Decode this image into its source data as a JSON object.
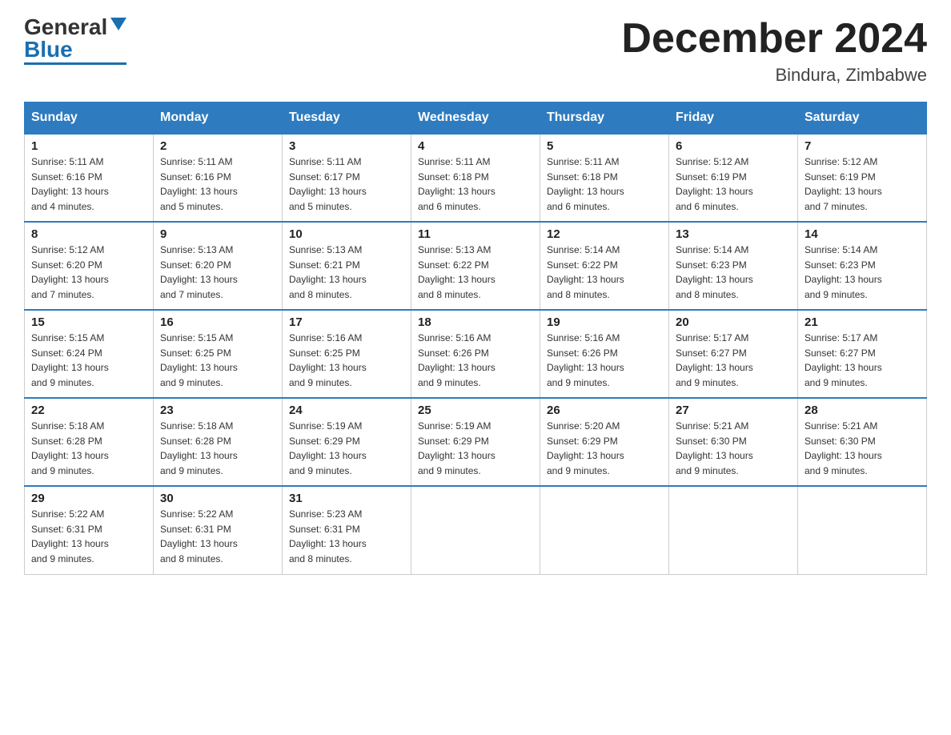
{
  "header": {
    "logo_general": "General",
    "logo_blue": "Blue",
    "month_title": "December 2024",
    "subtitle": "Bindura, Zimbabwe"
  },
  "weekdays": [
    "Sunday",
    "Monday",
    "Tuesday",
    "Wednesday",
    "Thursday",
    "Friday",
    "Saturday"
  ],
  "weeks": [
    [
      {
        "day": "1",
        "info": "Sunrise: 5:11 AM\nSunset: 6:16 PM\nDaylight: 13 hours\nand 4 minutes."
      },
      {
        "day": "2",
        "info": "Sunrise: 5:11 AM\nSunset: 6:16 PM\nDaylight: 13 hours\nand 5 minutes."
      },
      {
        "day": "3",
        "info": "Sunrise: 5:11 AM\nSunset: 6:17 PM\nDaylight: 13 hours\nand 5 minutes."
      },
      {
        "day": "4",
        "info": "Sunrise: 5:11 AM\nSunset: 6:18 PM\nDaylight: 13 hours\nand 6 minutes."
      },
      {
        "day": "5",
        "info": "Sunrise: 5:11 AM\nSunset: 6:18 PM\nDaylight: 13 hours\nand 6 minutes."
      },
      {
        "day": "6",
        "info": "Sunrise: 5:12 AM\nSunset: 6:19 PM\nDaylight: 13 hours\nand 6 minutes."
      },
      {
        "day": "7",
        "info": "Sunrise: 5:12 AM\nSunset: 6:19 PM\nDaylight: 13 hours\nand 7 minutes."
      }
    ],
    [
      {
        "day": "8",
        "info": "Sunrise: 5:12 AM\nSunset: 6:20 PM\nDaylight: 13 hours\nand 7 minutes."
      },
      {
        "day": "9",
        "info": "Sunrise: 5:13 AM\nSunset: 6:20 PM\nDaylight: 13 hours\nand 7 minutes."
      },
      {
        "day": "10",
        "info": "Sunrise: 5:13 AM\nSunset: 6:21 PM\nDaylight: 13 hours\nand 8 minutes."
      },
      {
        "day": "11",
        "info": "Sunrise: 5:13 AM\nSunset: 6:22 PM\nDaylight: 13 hours\nand 8 minutes."
      },
      {
        "day": "12",
        "info": "Sunrise: 5:14 AM\nSunset: 6:22 PM\nDaylight: 13 hours\nand 8 minutes."
      },
      {
        "day": "13",
        "info": "Sunrise: 5:14 AM\nSunset: 6:23 PM\nDaylight: 13 hours\nand 8 minutes."
      },
      {
        "day": "14",
        "info": "Sunrise: 5:14 AM\nSunset: 6:23 PM\nDaylight: 13 hours\nand 9 minutes."
      }
    ],
    [
      {
        "day": "15",
        "info": "Sunrise: 5:15 AM\nSunset: 6:24 PM\nDaylight: 13 hours\nand 9 minutes."
      },
      {
        "day": "16",
        "info": "Sunrise: 5:15 AM\nSunset: 6:25 PM\nDaylight: 13 hours\nand 9 minutes."
      },
      {
        "day": "17",
        "info": "Sunrise: 5:16 AM\nSunset: 6:25 PM\nDaylight: 13 hours\nand 9 minutes."
      },
      {
        "day": "18",
        "info": "Sunrise: 5:16 AM\nSunset: 6:26 PM\nDaylight: 13 hours\nand 9 minutes."
      },
      {
        "day": "19",
        "info": "Sunrise: 5:16 AM\nSunset: 6:26 PM\nDaylight: 13 hours\nand 9 minutes."
      },
      {
        "day": "20",
        "info": "Sunrise: 5:17 AM\nSunset: 6:27 PM\nDaylight: 13 hours\nand 9 minutes."
      },
      {
        "day": "21",
        "info": "Sunrise: 5:17 AM\nSunset: 6:27 PM\nDaylight: 13 hours\nand 9 minutes."
      }
    ],
    [
      {
        "day": "22",
        "info": "Sunrise: 5:18 AM\nSunset: 6:28 PM\nDaylight: 13 hours\nand 9 minutes."
      },
      {
        "day": "23",
        "info": "Sunrise: 5:18 AM\nSunset: 6:28 PM\nDaylight: 13 hours\nand 9 minutes."
      },
      {
        "day": "24",
        "info": "Sunrise: 5:19 AM\nSunset: 6:29 PM\nDaylight: 13 hours\nand 9 minutes."
      },
      {
        "day": "25",
        "info": "Sunrise: 5:19 AM\nSunset: 6:29 PM\nDaylight: 13 hours\nand 9 minutes."
      },
      {
        "day": "26",
        "info": "Sunrise: 5:20 AM\nSunset: 6:29 PM\nDaylight: 13 hours\nand 9 minutes."
      },
      {
        "day": "27",
        "info": "Sunrise: 5:21 AM\nSunset: 6:30 PM\nDaylight: 13 hours\nand 9 minutes."
      },
      {
        "day": "28",
        "info": "Sunrise: 5:21 AM\nSunset: 6:30 PM\nDaylight: 13 hours\nand 9 minutes."
      }
    ],
    [
      {
        "day": "29",
        "info": "Sunrise: 5:22 AM\nSunset: 6:31 PM\nDaylight: 13 hours\nand 9 minutes."
      },
      {
        "day": "30",
        "info": "Sunrise: 5:22 AM\nSunset: 6:31 PM\nDaylight: 13 hours\nand 8 minutes."
      },
      {
        "day": "31",
        "info": "Sunrise: 5:23 AM\nSunset: 6:31 PM\nDaylight: 13 hours\nand 8 minutes."
      },
      null,
      null,
      null,
      null
    ]
  ]
}
